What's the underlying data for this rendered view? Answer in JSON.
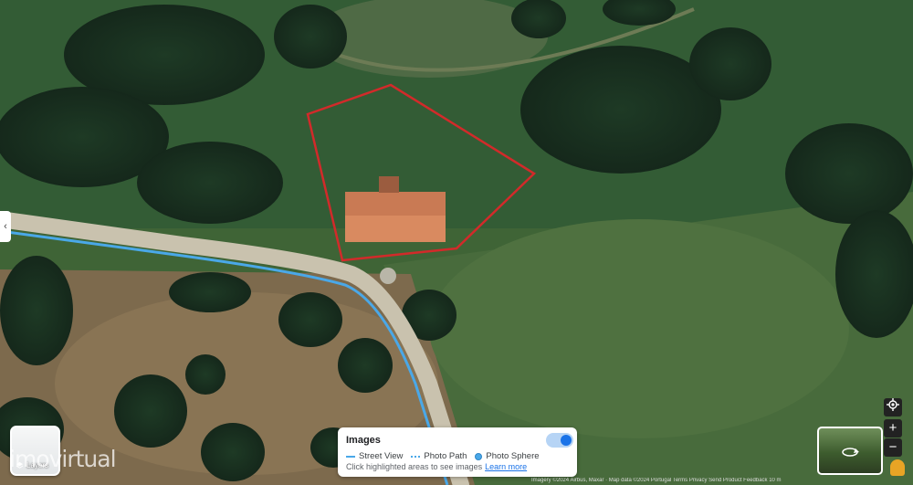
{
  "images_panel": {
    "title": "Images",
    "legend": [
      "Street View",
      "Photo Path",
      "Photo Sphere"
    ],
    "hint": "Click highlighted areas to see images",
    "learn_more": "Learn more",
    "toggle_on": true
  },
  "layers": {
    "label": "Layers"
  },
  "watermark": "imovirtual",
  "controls": {
    "zoom_in": "+",
    "zoom_out": "−"
  },
  "footer": "Imagery ©2024 Airbus, Maxar · Map data ©2024  Portugal  Terms  Privacy  Send Product Feedback  10 m",
  "colors": {
    "street_view": "#4aa8e8",
    "parcel_outline": "#d22a2a"
  },
  "icons": {
    "my_location": "crosshair-icon",
    "layers": "layers-icon",
    "pegman": "pegman-icon"
  }
}
